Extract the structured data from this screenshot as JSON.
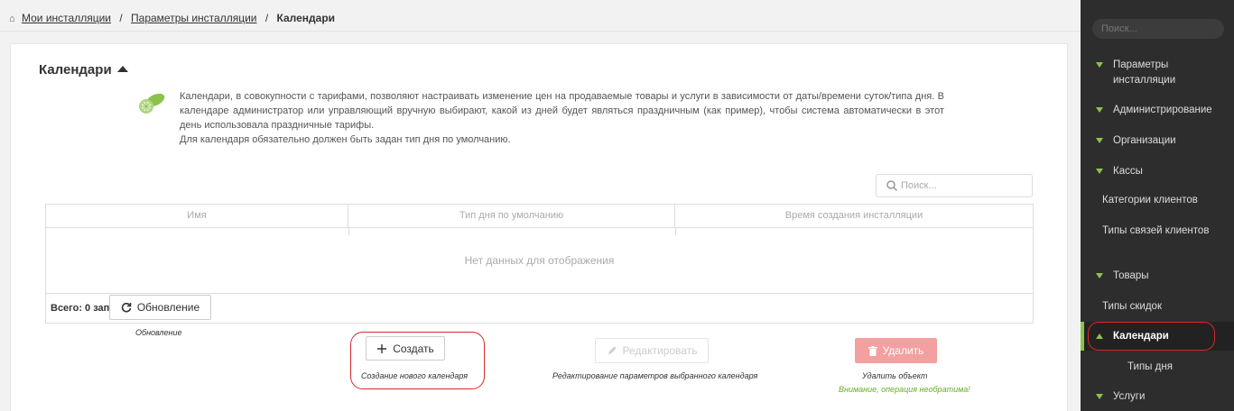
{
  "breadcrumb": {
    "home_icon": "home-icon",
    "item1": "Мои инсталляции",
    "item2": "Параметры инсталляции",
    "current": "Календари",
    "sep": "/"
  },
  "panel": {
    "title": "Календари",
    "description_line1": "Календари, в совокупности с тарифами, позволяют настраивать изменение цен на продаваемые товары и услуги в зависимости от даты/времени суток/типа дня. В календаре администратор или управляющий вручную выбирают, какой из дней будет являться праздничным (как пример), чтобы система автоматически в этот день использовала праздничные тарифы.",
    "description_line2": "Для календаря обязательно должен быть задан тип дня по умолчанию."
  },
  "search": {
    "placeholder": "Поиск..."
  },
  "grid": {
    "columns": [
      "Имя",
      "Тип дня по умолчанию",
      "Время создания инсталляции"
    ],
    "empty_text": "Нет данных для отображения",
    "footer": "Всего: 0 записей"
  },
  "actions": {
    "refresh": {
      "label": "Обновление",
      "caption": "Обновление"
    },
    "create": {
      "label": "Создать",
      "caption": "Создание нового календаря"
    },
    "edit": {
      "label": "Редактировать",
      "caption": "Редактирование параметров выбранного календаря"
    },
    "delete": {
      "label": "Удалить",
      "caption": "Удалить объект",
      "warning": "Внимание, операция необратима!"
    }
  },
  "sidebar": {
    "search_placeholder": "Поиск...",
    "items": [
      {
        "label": "Параметры инсталляции"
      },
      {
        "label": "Администрирование"
      },
      {
        "label": "Организации"
      },
      {
        "label": "Кассы"
      },
      {
        "label": "Категории клиентов"
      },
      {
        "label": "Типы связей клиентов"
      },
      {
        "label": "Товары"
      },
      {
        "label": "Типы скидок"
      },
      {
        "label": "Календари"
      },
      {
        "label": "Типы дня"
      },
      {
        "label": "Услуги"
      }
    ]
  },
  "colors": {
    "accent": "#8bc34a",
    "danger": "#f2a0a0",
    "highlight": "#d42a2a",
    "sidebar_bg": "#2d2d2d"
  }
}
